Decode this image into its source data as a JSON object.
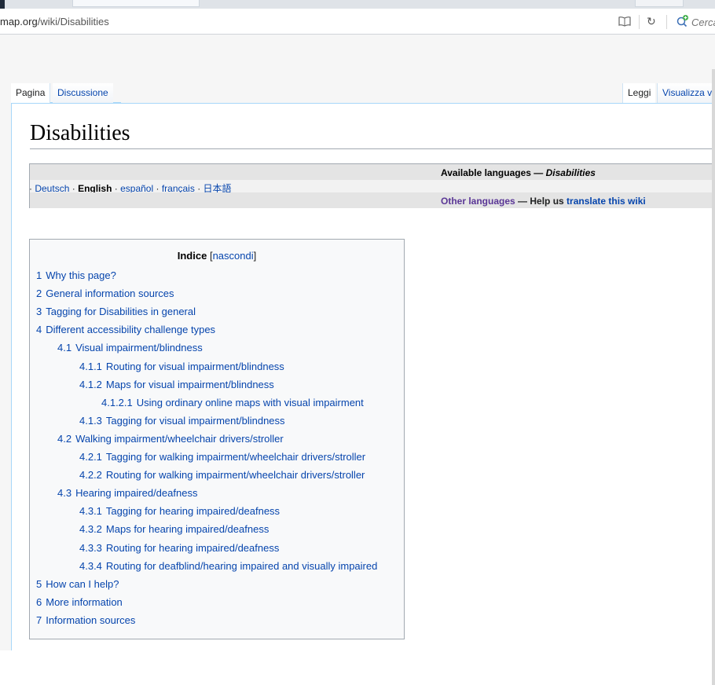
{
  "browser": {
    "url_domain": "map.org",
    "url_path": "/wiki/Disabilities",
    "search_placeholder": "Cerca",
    "icons": {
      "reader": "reader-view-icon",
      "reload": "reload-icon",
      "search": "search-engine-icon"
    }
  },
  "tabs": {
    "left": [
      {
        "label": "Pagina",
        "selected": true
      },
      {
        "label": "Discussione",
        "selected": false
      }
    ],
    "right": [
      {
        "label": "Leggi",
        "selected": true
      },
      {
        "label": "Visualizza v",
        "selected": false
      }
    ]
  },
  "page": {
    "title": "Disabilities"
  },
  "languages": {
    "heading_prefix": "Available languages — ",
    "heading_page": "Disabilities",
    "list": [
      "Deutsch",
      "English",
      "español",
      "français",
      "日本語"
    ],
    "current": "English",
    "other_languages": "Other languages",
    "help_text": " — Help us ",
    "translate_link": "translate this wiki"
  },
  "toc": {
    "title": "Indice",
    "toggle": "nascondi",
    "items": [
      {
        "num": "1",
        "text": "Why this page?",
        "level": 1
      },
      {
        "num": "2",
        "text": "General information sources",
        "level": 1
      },
      {
        "num": "3",
        "text": "Tagging for Disabilities in general",
        "level": 1
      },
      {
        "num": "4",
        "text": "Different accessibility challenge types",
        "level": 1
      },
      {
        "num": "4.1",
        "text": "Visual impairment/blindness",
        "level": 2
      },
      {
        "num": "4.1.1",
        "text": "Routing for visual impairment/blindness",
        "level": 3
      },
      {
        "num": "4.1.2",
        "text": "Maps for visual impairment/blindness",
        "level": 3
      },
      {
        "num": "4.1.2.1",
        "text": "Using ordinary online maps with visual impairment",
        "level": 4
      },
      {
        "num": "4.1.3",
        "text": "Tagging for visual impairment/blindness",
        "level": 3
      },
      {
        "num": "4.2",
        "text": "Walking impairment/wheelchair drivers/stroller",
        "level": 2
      },
      {
        "num": "4.2.1",
        "text": "Tagging for walking impairment/wheelchair drivers/stroller",
        "level": 3
      },
      {
        "num": "4.2.2",
        "text": "Routing for walking impairment/wheelchair drivers/stroller",
        "level": 3
      },
      {
        "num": "4.3",
        "text": "Hearing impaired/deafness",
        "level": 2
      },
      {
        "num": "4.3.1",
        "text": "Tagging for hearing impaired/deafness",
        "level": 3
      },
      {
        "num": "4.3.2",
        "text": "Maps for hearing impaired/deafness",
        "level": 3
      },
      {
        "num": "4.3.3",
        "text": "Routing for hearing impaired/deafness",
        "level": 3
      },
      {
        "num": "4.3.4",
        "text": "Routing for deafblind/hearing impaired and visually impaired",
        "level": 3
      },
      {
        "num": "5",
        "text": "How can I help?",
        "level": 1
      },
      {
        "num": "6",
        "text": "More information",
        "level": 1
      },
      {
        "num": "7",
        "text": "Information sources",
        "level": 1
      }
    ]
  },
  "colors": {
    "link": "#0645ad",
    "visited": "#5a3696",
    "tab_border": "#a7d7f9"
  }
}
